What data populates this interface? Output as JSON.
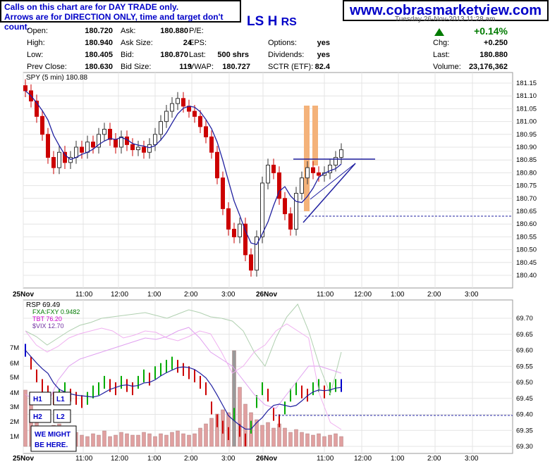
{
  "note": {
    "line1": "Calls on this chart are for DAY TRADE only.",
    "line2": "Arrows are for DIRECTION ONLY, time and target don't count."
  },
  "website": "www.cobrasmarketview.com",
  "signals": {
    "ls": "LS",
    "h": "H",
    "rs": "RS"
  },
  "header": {
    "date_partial": "Tuesday  26-Nov-2013  11:28 am"
  },
  "quote": {
    "open_label": "Open:",
    "open": "180.720",
    "high_label": "High:",
    "high": "180.940",
    "low_label": "Low:",
    "low": "180.405",
    "prev_label": "Prev Close:",
    "prev": "180.630",
    "ask_label": "Ask:",
    "ask": "180.880",
    "asksize_label": "Ask Size:",
    "asksize": "24",
    "bid_label": "Bid:",
    "bid": "180.870",
    "bidsize_label": "Bid Size:",
    "bidsize": "119",
    "pe_label": "P/E:",
    "eps_label": "EPS:",
    "last_label": "Last:",
    "lastsize": "500 shrs",
    "vwap_label": "VWAP:",
    "vwap": "180.727",
    "options_label": "Options:",
    "options": "yes",
    "div_label": "Dividends:",
    "div": "yes",
    "sctr_label": "SCTR (ETF):",
    "sctr": "82.4",
    "change_pct": "+0.14%",
    "chg_label": "Chg:",
    "chg": "+0.250",
    "last2_label": "Last:",
    "last": "180.880",
    "volume_label": "Volume:",
    "volume": "23,176,362"
  },
  "colors": {
    "up": "#00aa00",
    "down": "#cc0000",
    "accent": "#0000c8",
    "volume": "#e0a0a0",
    "ma": "#2020a0",
    "signal_bar": "#f4b27a"
  },
  "chart_data": [
    {
      "type": "line",
      "title": "SPY (5 min) 180.88",
      "xticks": [
        "25Nov",
        "11:00",
        "12:00",
        "1:00",
        "2:00",
        "3:00",
        "26Nov",
        "11:00",
        "12:00",
        "1:00",
        "2:00",
        "3:00"
      ],
      "yticks": [
        "181.15",
        "181.10",
        "181.05",
        "181.00",
        "180.95",
        "180.90",
        "180.85",
        "180.80",
        "180.75",
        "180.70",
        "180.65",
        "180.60",
        "180.55",
        "180.50",
        "180.45",
        "180.40"
      ],
      "ylim": [
        180.37,
        181.17
      ],
      "series": [
        {
          "values": [
            181.12,
            181.08,
            181.02,
            180.95,
            180.86,
            180.82,
            180.88,
            180.84,
            180.86,
            180.9,
            180.88,
            180.92,
            180.9,
            180.95,
            180.97,
            180.93,
            180.9,
            180.94,
            180.91,
            180.89,
            180.9,
            180.88,
            180.91,
            180.95,
            181.0,
            181.04,
            181.07,
            181.09,
            181.06,
            181.04,
            181.02,
            180.98,
            180.94,
            180.88,
            180.78,
            180.66,
            180.58,
            180.55,
            180.6,
            180.48,
            180.42,
            180.55,
            180.76,
            180.83,
            180.8,
            180.7,
            180.64,
            180.58,
            180.72,
            180.78,
            180.82,
            180.8,
            180.79,
            180.8,
            180.83,
            180.86,
            180.89
          ]
        }
      ],
      "levels": {
        "resistance": 180.85,
        "dashed": 180.63
      },
      "grid": true
    },
    {
      "type": "line",
      "title": "RSP 69.49",
      "legend": [
        "FXA:FXY 0.9482",
        "TBT 76.20",
        "$VIX 12.70"
      ],
      "yticks": [
        "69.70",
        "69.65",
        "69.60",
        "69.55",
        "69.50",
        "69.45",
        "69.40",
        "69.35",
        "69.30"
      ],
      "volume_ticks": [
        "7M",
        "6M",
        "5M",
        "4M",
        "3M",
        "2M",
        "1M"
      ],
      "ylim": [
        69.29,
        69.72
      ],
      "levels": {
        "dashed": 69.4
      },
      "boxes": [
        "H1",
        "L1",
        "H2",
        "L2",
        "WE MIGHT BE HERE."
      ]
    }
  ]
}
